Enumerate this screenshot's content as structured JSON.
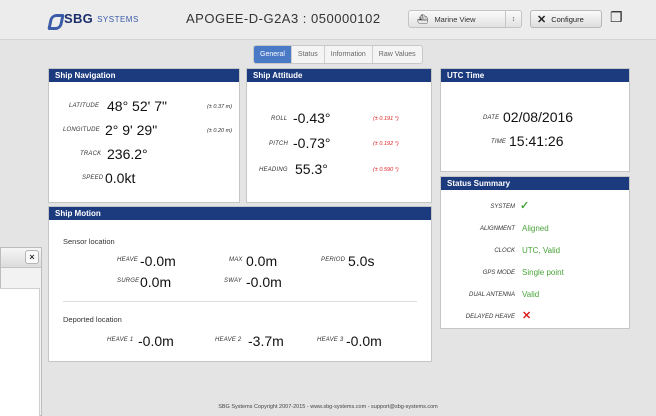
{
  "header": {
    "brand": "SBG",
    "brand_suffix": "SYSTEMS",
    "device_title": "APOGEE-D-G2A3 : 050000102",
    "view_select": "Marine View",
    "configure_label": "Configure"
  },
  "tabs": [
    "General",
    "Status",
    "Information",
    "Raw Values"
  ],
  "ship_navigation": {
    "title": "Ship Navigation",
    "latitude_label": "LATITUDE",
    "latitude_value": "48° 52' 7\"",
    "latitude_accuracy": "(± 0.37 m)",
    "longitude_label": "LONGITUDE",
    "longitude_value": "2° 9' 29\"",
    "longitude_accuracy": "(± 0.20 m)",
    "track_label": "TRACK",
    "track_value": "236.2°",
    "speed_label": "SPEED",
    "speed_value": "0.0kt"
  },
  "ship_attitude": {
    "title": "Ship Attitude",
    "roll_label": "ROLL",
    "roll_value": "-0.43°",
    "roll_accuracy": "(± 0.191 °)",
    "pitch_label": "PITCH",
    "pitch_value": "-0.73°",
    "pitch_accuracy": "(± 0.192 °)",
    "heading_label": "HEADING",
    "heading_value": "55.3°",
    "heading_accuracy": "(± 0.590 °)"
  },
  "utc_time": {
    "title": "UTC Time",
    "date_label": "DATE",
    "date_value": "02/08/2016",
    "time_label": "TIME",
    "time_value": "15:41:26"
  },
  "status_summary": {
    "title": "Status Summary",
    "system_label": "SYSTEM",
    "alignment_label": "ALIGNMENT",
    "alignment_value": "Aligned",
    "clock_label": "CLOCK",
    "clock_value": "UTC, Valid",
    "gps_mode_label": "GPS MODE",
    "gps_mode_value": "Single point",
    "dual_antenna_label": "DUAL ANTENNA",
    "dual_antenna_value": "Valid",
    "delayed_heave_label": "DELAYED HEAVE",
    "ok_color": "#4aa33a",
    "error_color": "#dd2222"
  },
  "ship_motion": {
    "title": "Ship Motion",
    "sensor_location_label": "Sensor location",
    "heave_label": "HEAVE",
    "heave_value": "-0.0m",
    "max_label": "MAX",
    "max_value": "0.0m",
    "period_label": "PERIOD",
    "period_value": "5.0s",
    "surge_label": "SURGE",
    "surge_value": "0.0m",
    "sway_label": "SWAY",
    "sway_value": "-0.0m",
    "deported_location_label": "Deported location",
    "heave1_label": "HEAVE 1",
    "heave1_value": "-0.0m",
    "heave2_label": "HEAVE 2",
    "heave2_value": "-3.7m",
    "heave3_label": "HEAVE 3",
    "heave3_value": "-0.0m"
  },
  "dialog": {
    "close_glyph": "×"
  },
  "footer": {
    "text": "SBG Systems Copyright 2007-2015 - www.sbg-systems.com - support@sbg-systems.com"
  },
  "colors": {
    "panel_header": "#1c3b7e",
    "active_tab": "#4a7ac6",
    "accuracy_red": "#dd2222"
  }
}
